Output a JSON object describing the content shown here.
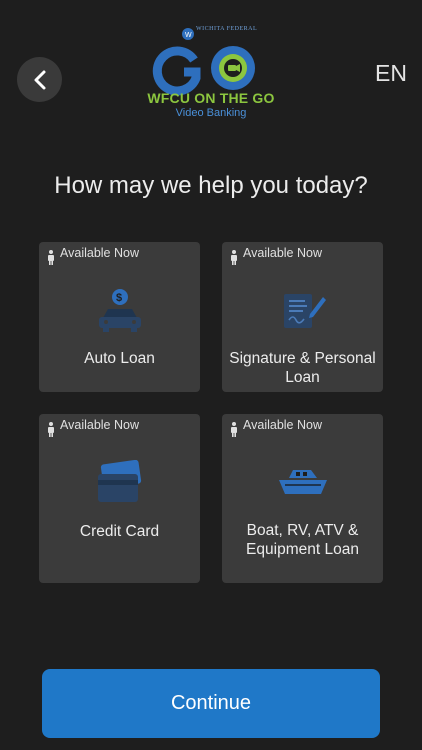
{
  "header": {
    "language": "EN",
    "logo": {
      "bank_name": "WICHITA FEDERAL",
      "title": "WFCU ON THE GO",
      "subtitle": "Video Banking"
    }
  },
  "headline": "How may we help you today?",
  "cards": [
    {
      "status": "Available Now",
      "label": "Auto Loan",
      "icon": "car-dollar-icon"
    },
    {
      "status": "Available Now",
      "label": "Signature & Personal Loan",
      "icon": "signature-document-icon"
    },
    {
      "status": "Available Now",
      "label": "Credit Card",
      "icon": "credit-card-icon"
    },
    {
      "status": "Available Now",
      "label": "Boat, RV, ATV & Equipment Loan",
      "icon": "boat-icon"
    }
  ],
  "continue_label": "Continue",
  "colors": {
    "background": "#1e1e1e",
    "card": "#3b3b3b",
    "accent": "#1f78c8",
    "icon_blue": "#2e6fbd",
    "logo_green": "#8cc63f"
  }
}
